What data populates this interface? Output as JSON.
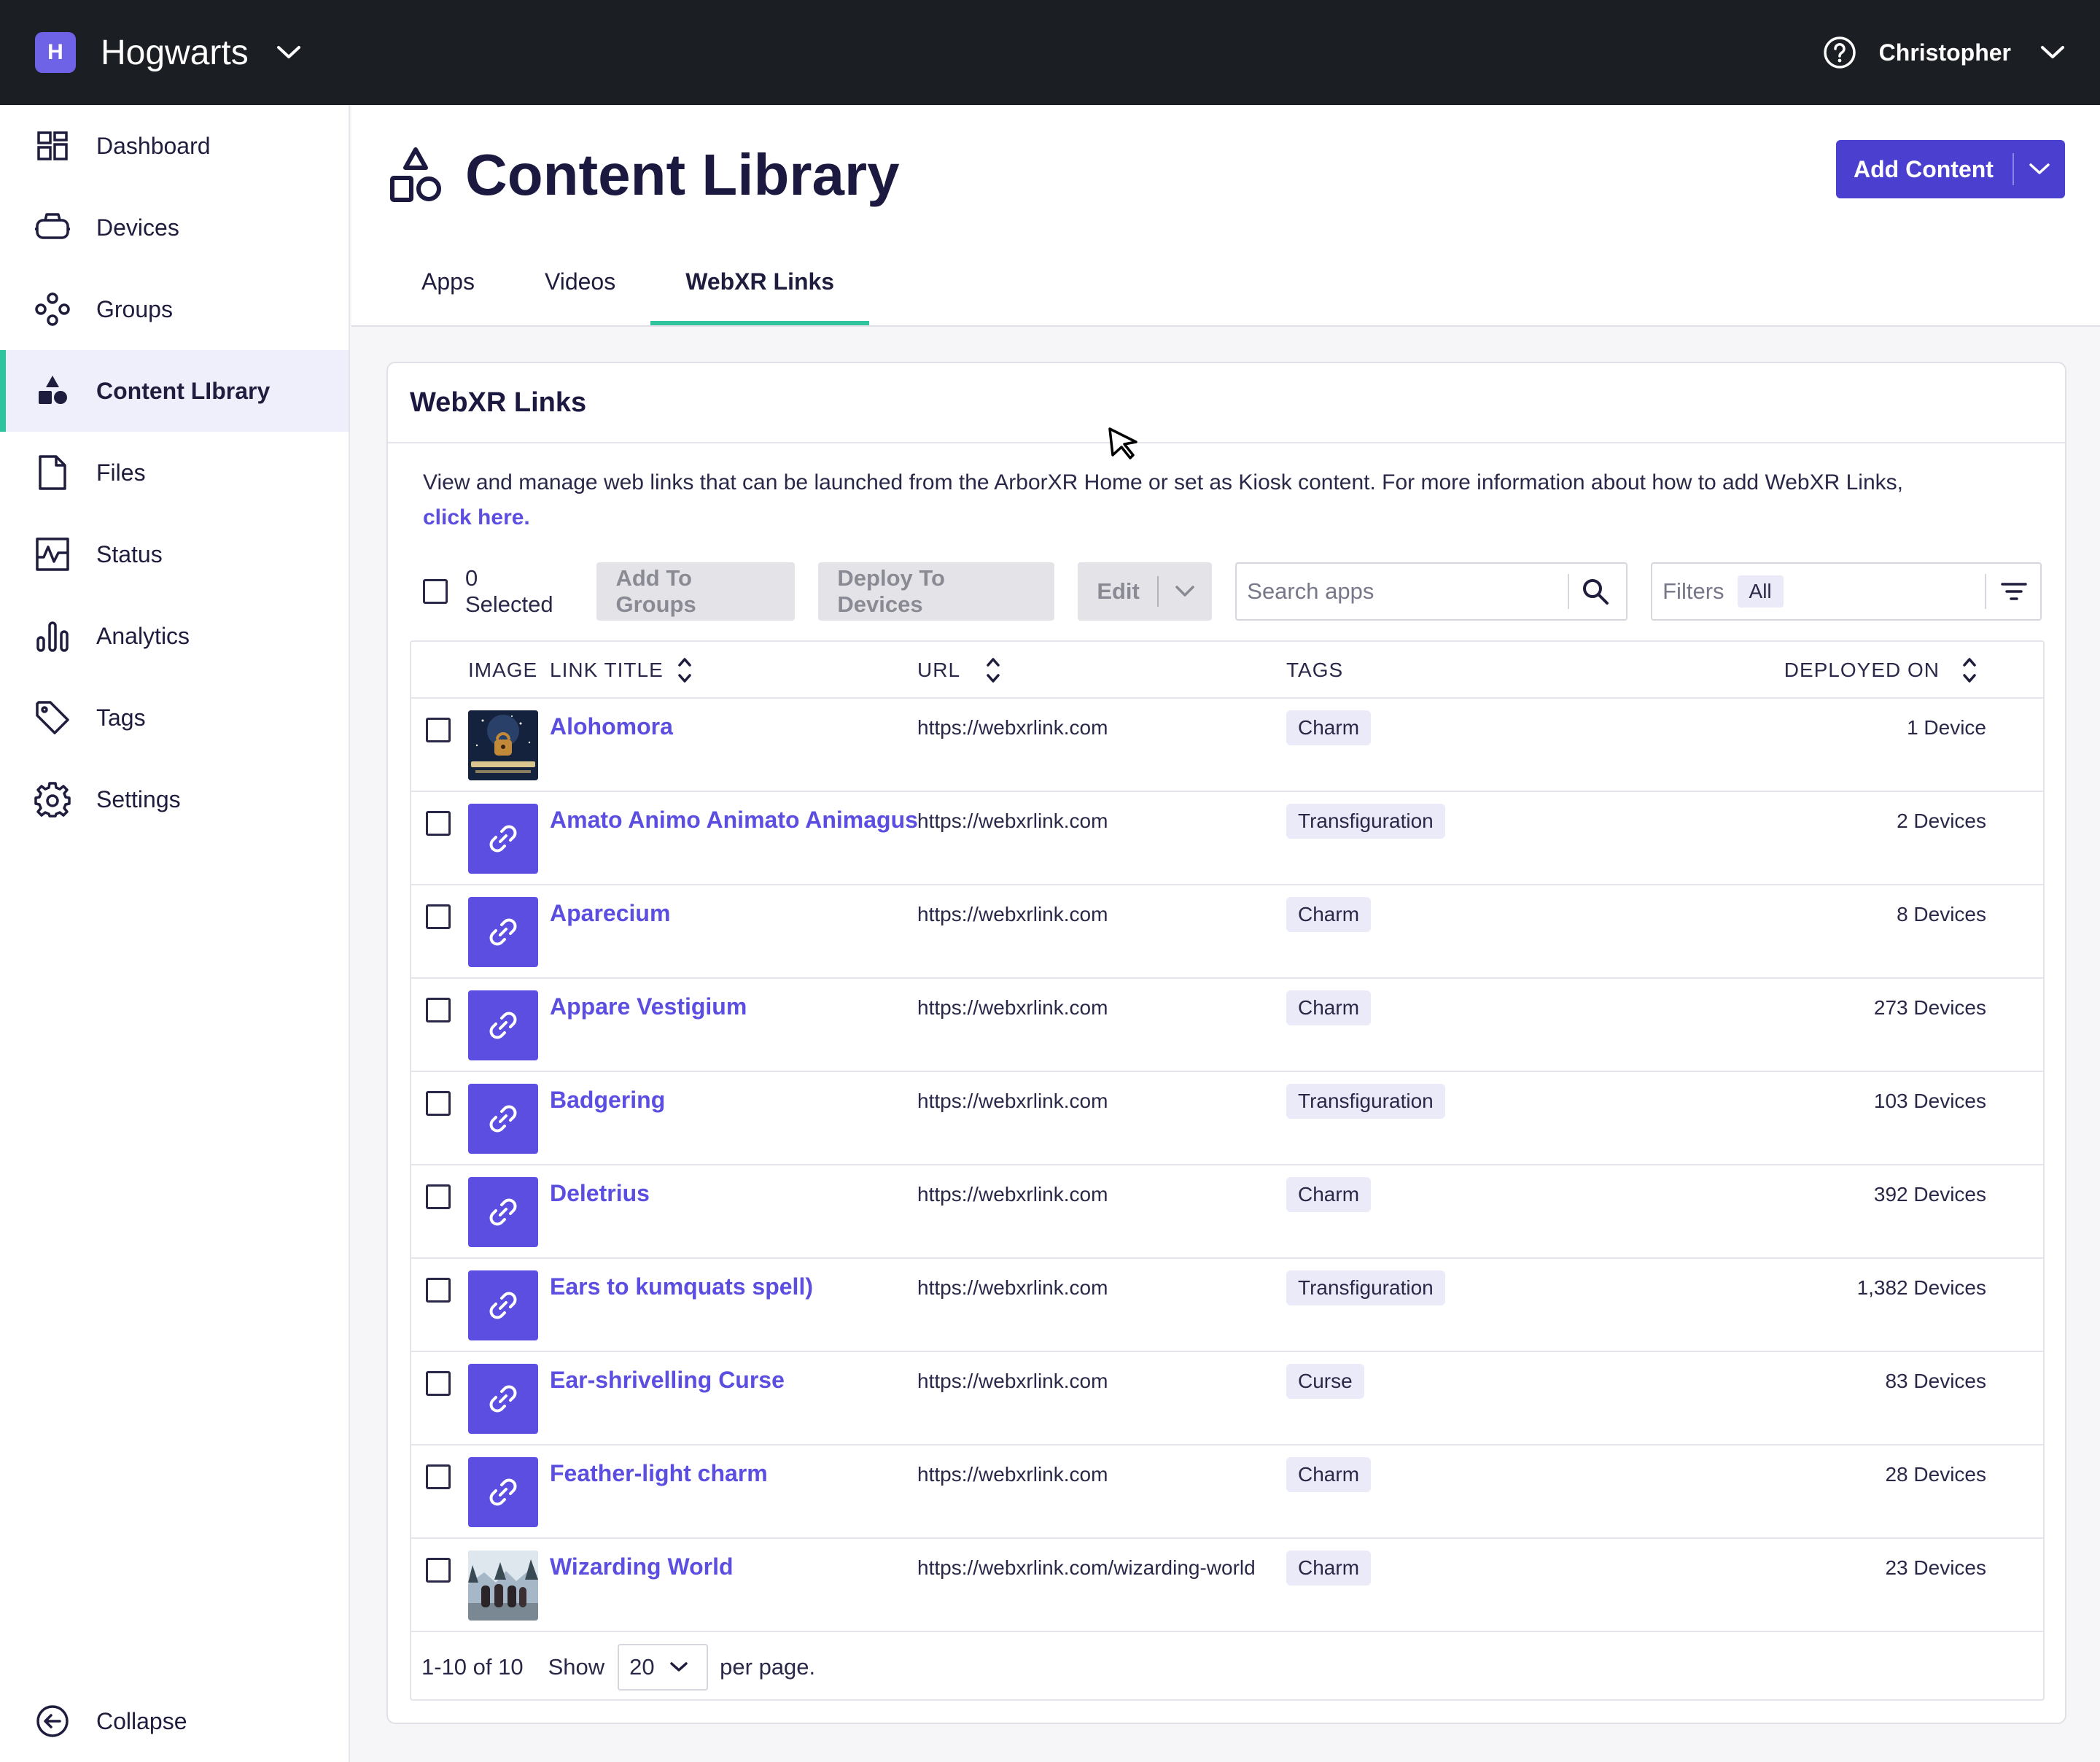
{
  "topbar": {
    "org_initial": "H",
    "org_name": "Hogwarts",
    "user_name": "Christopher"
  },
  "sidebar": {
    "items": [
      {
        "label": "Dashboard",
        "icon": "dashboard-icon"
      },
      {
        "label": "Devices",
        "icon": "headset-icon"
      },
      {
        "label": "Groups",
        "icon": "groups-icon"
      },
      {
        "label": "Content LIbrary",
        "icon": "shapes-icon",
        "active": true
      },
      {
        "label": "Files",
        "icon": "file-icon"
      },
      {
        "label": "Status",
        "icon": "pulse-icon"
      },
      {
        "label": "Analytics",
        "icon": "bar-chart-icon"
      },
      {
        "label": "Tags",
        "icon": "tag-icon"
      },
      {
        "label": "Settings",
        "icon": "gear-icon"
      }
    ],
    "collapse_label": "Collapse"
  },
  "header": {
    "title": "Content Library",
    "add_button": "Add Content",
    "tabs": [
      {
        "label": "Apps"
      },
      {
        "label": "Videos"
      },
      {
        "label": "WebXR Links",
        "active": true
      }
    ]
  },
  "card": {
    "title": "WebXR Links",
    "description": "View and manage web links that can be launched from the ArborXR Home or set as Kiosk content. For more information about how to add WebXR Links,",
    "link_text": "click here."
  },
  "toolbar": {
    "selected": "0 Selected",
    "add_groups": "Add To Groups",
    "deploy": "Deploy To Devices",
    "edit": "Edit",
    "search_placeholder": "Search apps",
    "filters_label": "Filters",
    "filters_value": "All"
  },
  "table": {
    "columns": {
      "image": "IMAGE",
      "title": "LINK TITLE",
      "url": "URL",
      "tags": "TAGS",
      "deployed": "DEPLOYED ON"
    },
    "rows": [
      {
        "title": "Alohomora",
        "url": "https://webxrlink.com",
        "tag": "Charm",
        "deployed": "1 Device",
        "thumb": "alohomora"
      },
      {
        "title": "Amato Animo Animato Animagus",
        "url": "https://webxrlink.com",
        "tag": "Transfiguration",
        "deployed": "2 Devices",
        "thumb": "link"
      },
      {
        "title": "Aparecium",
        "url": "https://webxrlink.com",
        "tag": "Charm",
        "deployed": "8 Devices",
        "thumb": "link"
      },
      {
        "title": "Appare Vestigium",
        "url": "https://webxrlink.com",
        "tag": "Charm",
        "deployed": "273 Devices",
        "thumb": "link"
      },
      {
        "title": "Badgering",
        "url": "https://webxrlink.com",
        "tag": "Transfiguration",
        "deployed": "103 Devices",
        "thumb": "link"
      },
      {
        "title": "Deletrius",
        "url": "https://webxrlink.com",
        "tag": "Charm",
        "deployed": "392 Devices",
        "thumb": "link"
      },
      {
        "title": "Ears to kumquats spell)",
        "url": "https://webxrlink.com",
        "tag": "Transfiguration",
        "deployed": "1,382 Devices",
        "thumb": "link"
      },
      {
        "title": "Ear-shrivelling Curse",
        "url": "https://webxrlink.com",
        "tag": "Curse",
        "deployed": "83 Devices",
        "thumb": "link"
      },
      {
        "title": "Feather-light charm",
        "url": "https://webxrlink.com",
        "tag": "Charm",
        "deployed": "28 Devices",
        "thumb": "link"
      },
      {
        "title": "Wizarding World",
        "url": "https://webxrlink.com/wizarding-world",
        "tag": "Charm",
        "deployed": "23 Devices",
        "thumb": "wizarding"
      }
    ]
  },
  "pagination": {
    "range": "1-10 of 10",
    "show": "Show",
    "per_page": "20",
    "per_page_suffix": "per page."
  },
  "colors": {
    "accent": "#4a3fcf",
    "link": "#5b4ee0",
    "active_indicator": "#2fc49b",
    "topbar": "#1b1e22"
  }
}
